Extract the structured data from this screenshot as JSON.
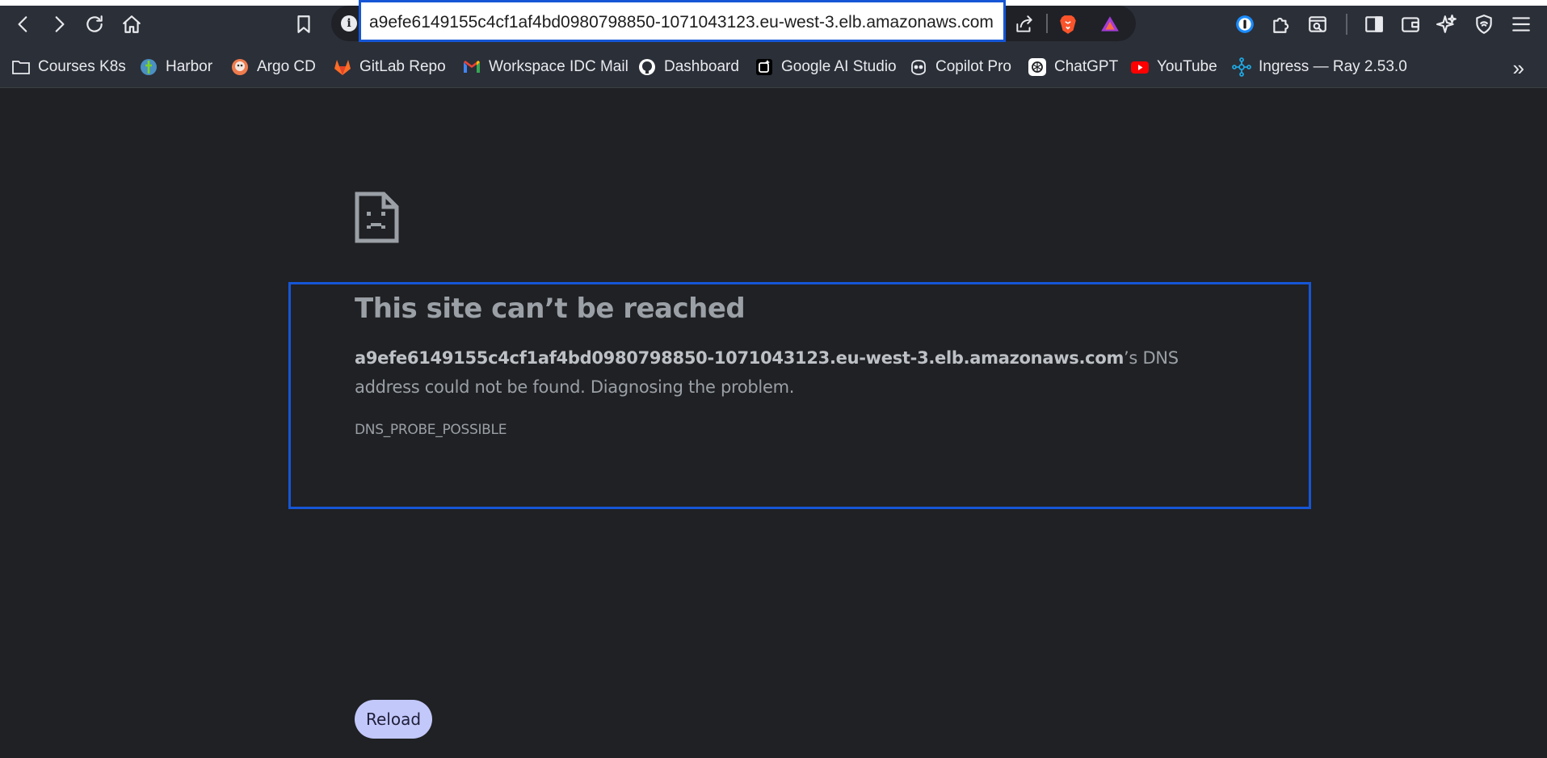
{
  "browser": {
    "url": "a9efe6149155c4cf1af4bd0980798850-1071043123.eu-west-3.elb.amazonaws.com",
    "site_info_glyph": "i"
  },
  "bookmarks": [
    {
      "label": "Courses K8s",
      "icon": "folder-icon"
    },
    {
      "label": "Harbor",
      "icon": "harbor-icon"
    },
    {
      "label": "Argo CD",
      "icon": "argocd-icon"
    },
    {
      "label": "GitLab Repo",
      "icon": "gitlab-icon"
    },
    {
      "label": "Workspace IDC Mail",
      "icon": "gmail-icon"
    },
    {
      "label": "Dashboard",
      "icon": "github-icon"
    },
    {
      "label": "Google AI Studio",
      "icon": "ai-studio-icon"
    },
    {
      "label": "Copilot Pro",
      "icon": "copilot-icon"
    },
    {
      "label": "ChatGPT",
      "icon": "chatgpt-icon"
    },
    {
      "label": "YouTube",
      "icon": "youtube-icon"
    },
    {
      "label": "Ingress — Ray 2.53.0",
      "icon": "ray-icon"
    }
  ],
  "bookmarks_more": "»",
  "error": {
    "title": "This site can’t be reached",
    "host": "a9efe6149155c4cf1af4bd0980798850-1071043123.eu-west-3.elb.amazonaws.com",
    "message_suffix": "’s DNS address could not be found. Diagnosing the problem.",
    "code": "DNS_PROBE_POSSIBLE",
    "reload_label": "Reload"
  },
  "colors": {
    "background": "#202124",
    "toolbar": "#2b2f38",
    "highlight": "#1656d6",
    "reload_button": "#c2c8fa"
  }
}
